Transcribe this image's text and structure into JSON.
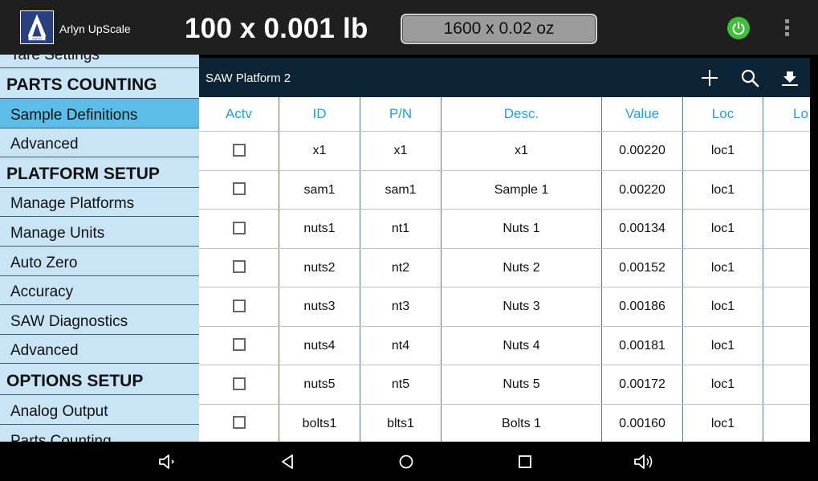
{
  "topbar": {
    "app_name": "Arlyn UpScale",
    "logo_text": "ARLYN",
    "weight_primary": "100 x 0.001 lb",
    "weight_secondary": "1600 x 0.02 oz",
    "power_color": "#3fbf3a"
  },
  "sidebar": {
    "items": [
      {
        "label": "Tare Settings",
        "type": "item",
        "selected": false
      },
      {
        "label": "PARTS COUNTING",
        "type": "header",
        "selected": false
      },
      {
        "label": "Sample Definitions",
        "type": "item",
        "selected": true
      },
      {
        "label": "Advanced",
        "type": "item",
        "selected": false
      },
      {
        "label": "PLATFORM SETUP",
        "type": "header",
        "selected": false
      },
      {
        "label": "Manage Platforms",
        "type": "item",
        "selected": false
      },
      {
        "label": "Manage Units",
        "type": "item",
        "selected": false
      },
      {
        "label": "Auto Zero",
        "type": "item",
        "selected": false
      },
      {
        "label": "Accuracy",
        "type": "item",
        "selected": false
      },
      {
        "label": "SAW Diagnostics",
        "type": "item",
        "selected": false
      },
      {
        "label": "Advanced",
        "type": "item",
        "selected": false
      },
      {
        "label": "OPTIONS SETUP",
        "type": "header",
        "selected": false
      },
      {
        "label": "Analog Output",
        "type": "item",
        "selected": false
      },
      {
        "label": "Parts Counting",
        "type": "item",
        "selected": false
      }
    ]
  },
  "panel": {
    "title": "SAW Platform 2",
    "icons": [
      "add-icon",
      "search-icon",
      "download-icon"
    ],
    "columns": [
      "Actv",
      "ID",
      "P/N",
      "Desc.",
      "Value",
      "Loc",
      "Lo"
    ],
    "rows": [
      {
        "active": false,
        "id": "x1",
        "pn": "x1",
        "desc": "x1",
        "value": "0.00220",
        "loc": "loc1",
        "lo": ""
      },
      {
        "active": false,
        "id": "sam1",
        "pn": "sam1",
        "desc": "Sample 1",
        "value": "0.00220",
        "loc": "loc1",
        "lo": ""
      },
      {
        "active": false,
        "id": "nuts1",
        "pn": "nt1",
        "desc": "Nuts 1",
        "value": "0.00134",
        "loc": "loc1",
        "lo": ""
      },
      {
        "active": false,
        "id": "nuts2",
        "pn": "nt2",
        "desc": "Nuts 2",
        "value": "0.00152",
        "loc": "loc1",
        "lo": ""
      },
      {
        "active": false,
        "id": "nuts3",
        "pn": "nt3",
        "desc": "Nuts 3",
        "value": "0.00186",
        "loc": "loc1",
        "lo": ""
      },
      {
        "active": false,
        "id": "nuts4",
        "pn": "nt4",
        "desc": "Nuts 4",
        "value": "0.00181",
        "loc": "loc1",
        "lo": ""
      },
      {
        "active": false,
        "id": "nuts5",
        "pn": "nt5",
        "desc": "Nuts 5",
        "value": "0.00172",
        "loc": "loc1",
        "lo": ""
      },
      {
        "active": false,
        "id": "bolts1",
        "pn": "blts1",
        "desc": "Bolts 1",
        "value": "0.00160",
        "loc": "loc1",
        "lo": ""
      }
    ]
  },
  "navbar": {
    "icons": [
      "volume-down-icon",
      "back-icon",
      "home-icon",
      "recents-icon",
      "volume-up-icon"
    ]
  }
}
